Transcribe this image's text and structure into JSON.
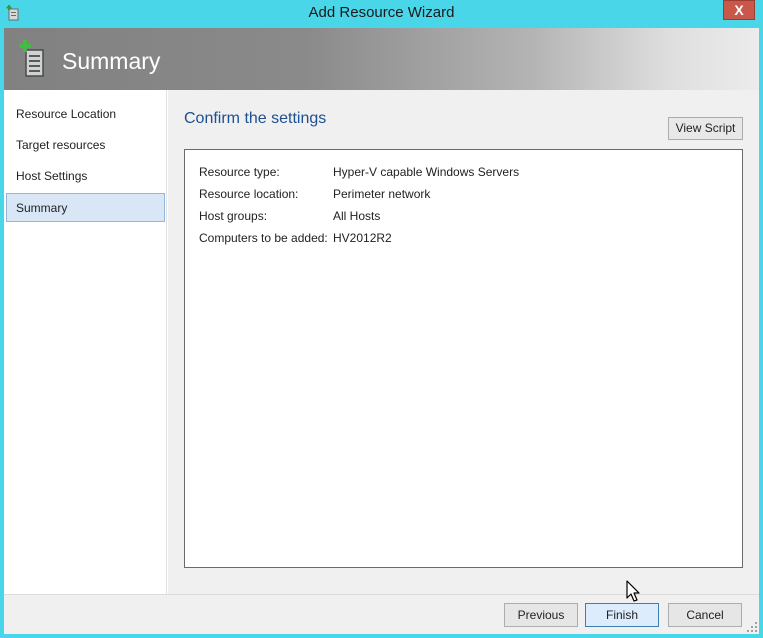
{
  "window": {
    "title": "Add Resource Wizard",
    "close_glyph": "X",
    "app_icon": "server-add-icon"
  },
  "header": {
    "title": "Summary",
    "icon": "server-add-icon"
  },
  "sidebar": {
    "items": [
      {
        "label": "Resource Location",
        "selected": false
      },
      {
        "label": "Target resources",
        "selected": false
      },
      {
        "label": "Host Settings",
        "selected": false
      },
      {
        "label": "Summary",
        "selected": true
      }
    ]
  },
  "main": {
    "title": "Confirm the settings",
    "view_script_label": "View Script",
    "summary": [
      {
        "label": "Resource type:",
        "value": "Hyper-V capable Windows Servers"
      },
      {
        "label": "Resource location:",
        "value": "Perimeter network"
      },
      {
        "label": "Host groups:",
        "value": "All Hosts"
      },
      {
        "label": "Computers to be added:",
        "value": "HV2012R2"
      }
    ]
  },
  "footer": {
    "previous_label": "Previous",
    "finish_label": "Finish",
    "cancel_label": "Cancel"
  },
  "colors": {
    "window_frame": "#49d6e8",
    "close_button": "#c9584b",
    "title_accent": "#1d4f91",
    "selection": "#d9e6f5"
  }
}
